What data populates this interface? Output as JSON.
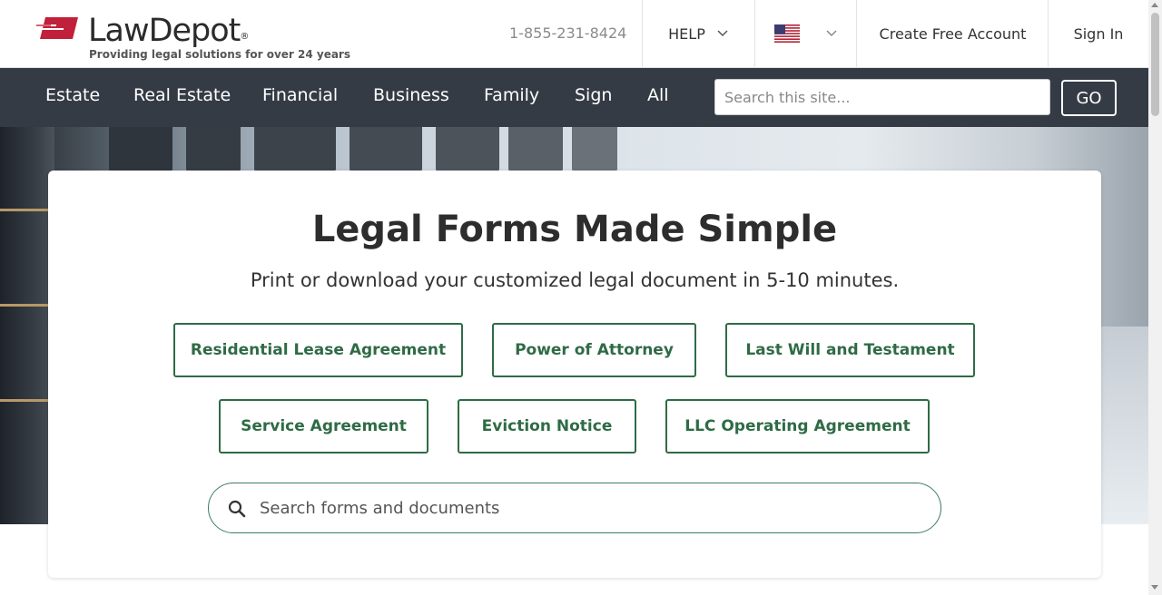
{
  "brand": {
    "name": "LawDepot",
    "registered": "®",
    "tagline": "Providing legal solutions for over 24 years",
    "logo_color": "#c0203a"
  },
  "header": {
    "phone": "1-855-231-8424",
    "help_label": "HELP",
    "locale_flag": "us-flag-icon",
    "create_account_label": "Create Free Account",
    "sign_in_label": "Sign In"
  },
  "nav": {
    "items": [
      {
        "label": "Estate"
      },
      {
        "label": "Real Estate"
      },
      {
        "label": "Financial"
      },
      {
        "label": "Business"
      },
      {
        "label": "Family"
      },
      {
        "label": "Sign"
      },
      {
        "label": "All"
      }
    ],
    "search_placeholder": "Search this site...",
    "go_label": "GO",
    "background": "#353b45"
  },
  "hero": {
    "title": "Legal Forms Made Simple",
    "subtitle": "Print or download your customized legal document in 5-10 minutes.",
    "accent_color": "#2f6b45",
    "documents": [
      {
        "label": "Residential Lease Agreement"
      },
      {
        "label": "Power of Attorney"
      },
      {
        "label": "Last Will and Testament"
      },
      {
        "label": "Service Agreement"
      },
      {
        "label": "Eviction Notice"
      },
      {
        "label": "LLC Operating Agreement"
      }
    ],
    "search_placeholder": "Search forms and documents"
  }
}
